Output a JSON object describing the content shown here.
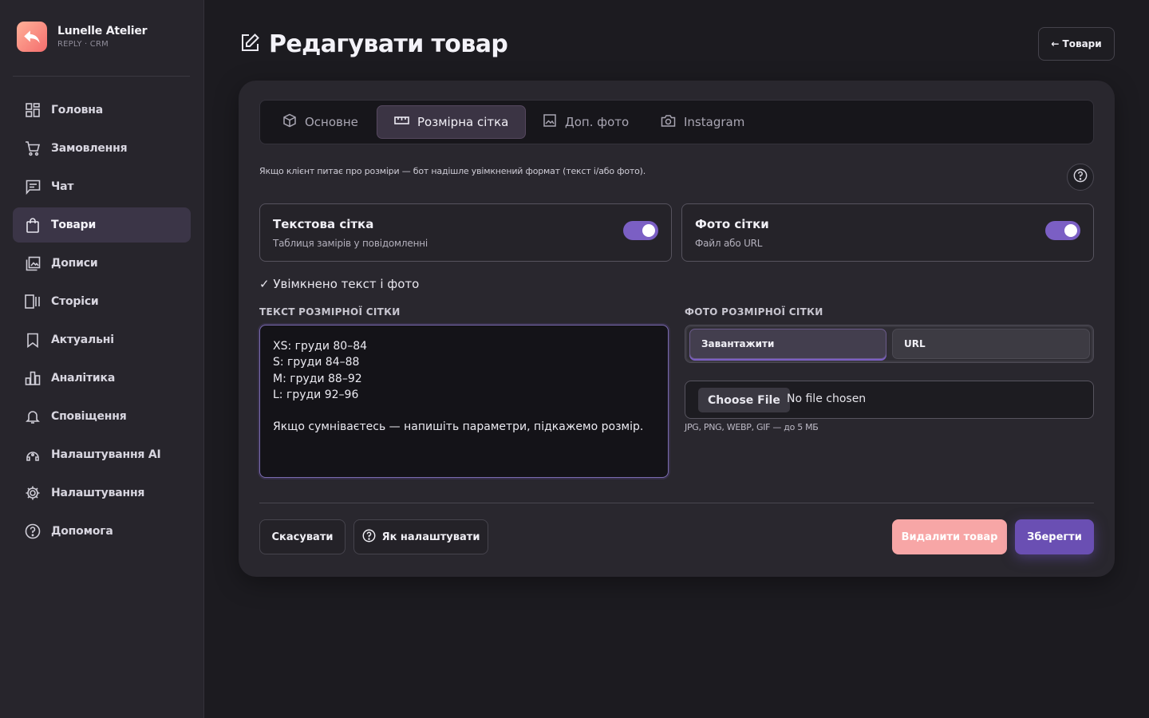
{
  "brand": {
    "name": "Lunelle Atelier",
    "subtitle": "REPLY · CRM"
  },
  "sidebar": {
    "items": [
      {
        "label": "Головна",
        "icon": "grid-icon",
        "active": false
      },
      {
        "label": "Замовлення",
        "icon": "cart-icon",
        "active": false
      },
      {
        "label": "Чат",
        "icon": "chat-icon",
        "active": false
      },
      {
        "label": "Товари",
        "icon": "bag-icon",
        "active": true
      },
      {
        "label": "Дописи",
        "icon": "gallery-icon",
        "active": false
      },
      {
        "label": "Сторіси",
        "icon": "stories-icon",
        "active": false
      },
      {
        "label": "Актуальні",
        "icon": "bookmark-icon",
        "active": false
      },
      {
        "label": "Аналітика",
        "icon": "chart-icon",
        "active": false
      },
      {
        "label": "Сповіщення",
        "icon": "bell-icon",
        "active": false
      },
      {
        "label": "Налаштування AI",
        "icon": "ai-icon",
        "active": false
      },
      {
        "label": "Налаштування",
        "icon": "gear-icon",
        "active": false
      },
      {
        "label": "Допомога",
        "icon": "help-icon",
        "active": false
      }
    ]
  },
  "header": {
    "title": "Редагувати товар",
    "back_label": "← Товари"
  },
  "tabs": [
    {
      "label": "Основне",
      "icon": "box-icon",
      "active": false
    },
    {
      "label": "Розмірна сітка",
      "icon": "ruler-icon",
      "active": true
    },
    {
      "label": "Доп. фото",
      "icon": "image-icon",
      "active": false
    },
    {
      "label": "Instagram",
      "icon": "camera-icon",
      "active": false
    }
  ],
  "hint": "Якщо клієнт питає про розміри — бот надішле увімкнений формат (текст і/або фото).",
  "toggles": {
    "text": {
      "title": "Текстова сітка",
      "subtitle": "Таблиця замірів у повідомленні",
      "on": true
    },
    "photo": {
      "title": "Фото сітки",
      "subtitle": "Файл або URL",
      "on": true
    }
  },
  "status": "✓ Увімкнено текст і фото",
  "text_section": {
    "label": "ТЕКСТ РОЗМІРНОЇ СІТКИ",
    "value": "XS: груди 80–84\nS: груди 84–88\nM: груди 88–92\nL: груди 92–96\n\nЯкщо сумніваєтесь — напишіть параметри, підкажемо розмір."
  },
  "photo_section": {
    "label": "ФОТО РОЗМІРНОЇ СІТКИ",
    "upload_label": "Завантажити",
    "url_label": "URL",
    "choose_file": "Choose File",
    "file_name": "No file chosen",
    "file_hint": "JPG, PNG, WEBP, GIF — до 5 МБ"
  },
  "actions": {
    "cancel": "Скасувати",
    "howto": "Як налаштувати",
    "delete": "Видалити товар",
    "save": "Зберегти"
  },
  "colors": {
    "accent": "#7b5fc4",
    "save": "#6a4fb3",
    "delete": "#f7a6a6",
    "logo": "#f46d6d"
  }
}
